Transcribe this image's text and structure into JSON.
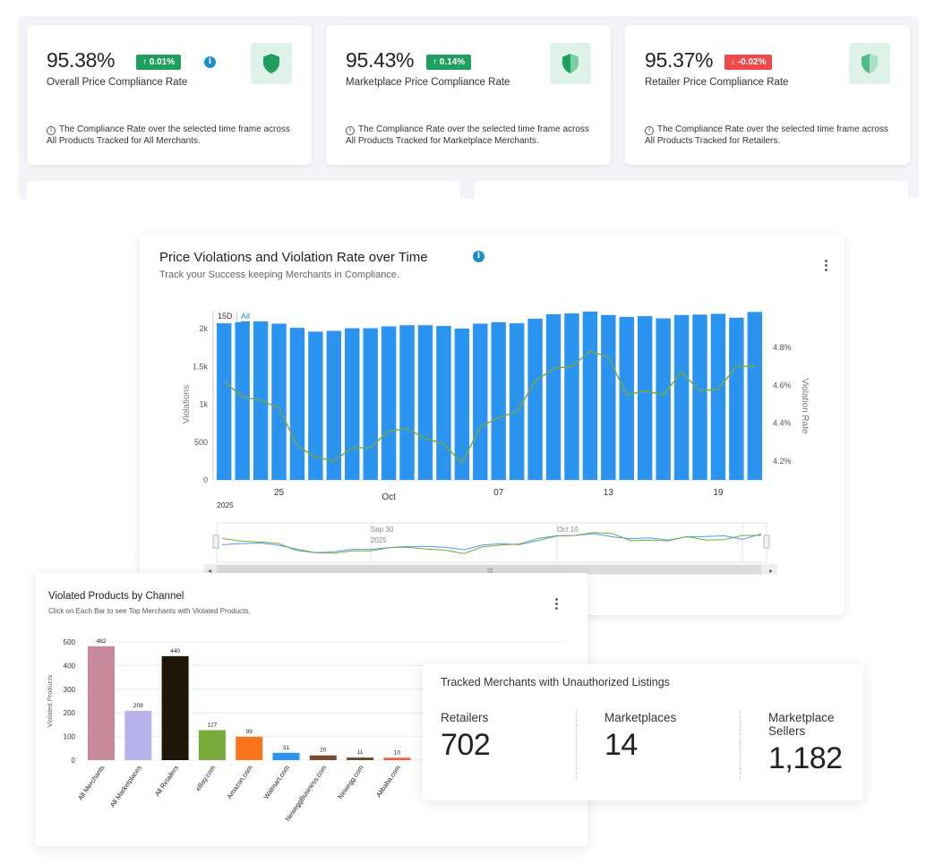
{
  "kpis": [
    {
      "value": "95.38%",
      "change": "↑ 0.01%",
      "direction": "up",
      "label": "Overall Price Compliance Rate",
      "note": "The Compliance Rate over the selected time frame across All Products Tracked for All Merchants.",
      "info": true
    },
    {
      "value": "95.43%",
      "change": "↑ 0.14%",
      "direction": "up",
      "label": "Marketplace Price Compliance Rate",
      "note": "The Compliance Rate over the selected time frame across All Products Tracked for Marketplace Merchants.",
      "info": false
    },
    {
      "value": "95.37%",
      "change": "↓ -0.02%",
      "direction": "down",
      "label": "Retailer Price Compliance Rate",
      "note": "The Compliance Rate over the selected time frame across All Products Tracked for Retailers.",
      "info": false
    }
  ],
  "colors": {
    "up": "#1f9f5d",
    "down": "#ef4a4a",
    "bar": "#2b93f0",
    "line": "#7aa93c",
    "shield": "#1f9f5d",
    "info": "#1a8fc9"
  },
  "main_chart": {
    "title": "Price Violations and Violation Rate over Time",
    "subtitle": "Track your Success keeping Merchants in Compliance.",
    "range_buttons": [
      "15D",
      "All"
    ],
    "selected_range": "All"
  },
  "violated_products": {
    "title": "Violated Products by Channel",
    "subtitle": "Click on Each Bar to see Top Merchants with Violated Products."
  },
  "tracked_merchants": {
    "title": "Tracked Merchants with Unauthorized Listings",
    "columns": [
      {
        "label": "Retailers",
        "value": "702"
      },
      {
        "label": "Marketplaces",
        "value": "14"
      },
      {
        "label": "Marketplace Sellers",
        "value": "1,182"
      }
    ]
  },
  "chart_data": [
    {
      "type": "bar",
      "title": "Price Violations and Violation Rate over Time",
      "ylabel": "Violations",
      "y2label": "Violation Rate",
      "ylim": [
        0,
        2000
      ],
      "yticks": [
        "0",
        "500",
        "1k",
        "1.5k",
        "2k"
      ],
      "y2lim": [
        4.1,
        4.9
      ],
      "y2ticks": [
        "4.2%",
        "4.4%",
        "4.6%",
        "4.8%"
      ],
      "xticks": [
        "25",
        "Oct",
        "07",
        "13",
        "19"
      ],
      "year_label": "2025",
      "navigator_labels": [
        "Sep 30 2025",
        "Oct 10"
      ],
      "bars": [
        2070,
        2085,
        2095,
        2065,
        2010,
        1960,
        1970,
        2005,
        2005,
        2030,
        2045,
        2045,
        2035,
        2000,
        2065,
        2085,
        2070,
        2130,
        2190,
        2200,
        2225,
        2180,
        2155,
        2165,
        2135,
        2180,
        2185,
        2195,
        2145,
        2220
      ],
      "rate_percent": [
        4.62,
        4.54,
        4.52,
        4.48,
        4.28,
        4.22,
        4.2,
        4.27,
        4.27,
        4.36,
        4.37,
        4.32,
        4.29,
        4.19,
        4.38,
        4.43,
        4.46,
        4.62,
        4.69,
        4.7,
        4.78,
        4.75,
        4.55,
        4.57,
        4.55,
        4.67,
        4.57,
        4.58,
        4.7,
        4.7
      ]
    },
    {
      "type": "bar",
      "title": "Violated Products by Channel",
      "ylabel": "Violated Products",
      "ylim": [
        0,
        500
      ],
      "yticks": [
        0,
        100,
        200,
        300,
        400,
        500
      ],
      "categories": [
        "All Merchants",
        "All Marketplaces",
        "All Retailers",
        "eBay.com",
        "Amazon.com",
        "Walmart.com",
        "NeweggBusiness.com",
        "Newegg.com",
        "Alibaba.com"
      ],
      "values": [
        482,
        209,
        440,
        127,
        99,
        31,
        20,
        11,
        10
      ],
      "colors": [
        "#c9899c",
        "#b9b3ec",
        "#1e1709",
        "#7aa93c",
        "#f8731c",
        "#2b93f0",
        "#7a4a2e",
        "#6b4a2e",
        "#f25a3b"
      ]
    }
  ]
}
